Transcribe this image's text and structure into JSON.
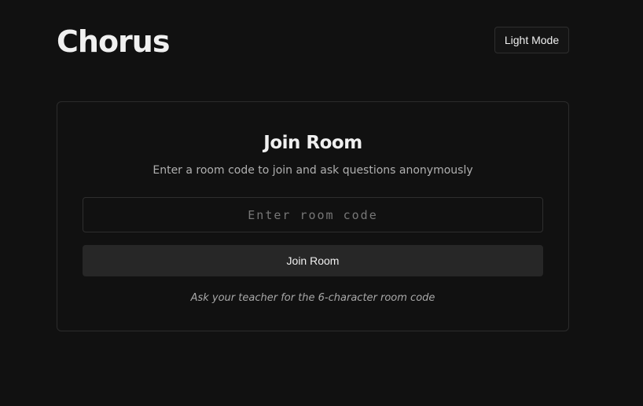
{
  "header": {
    "app_title": "Chorus",
    "theme_toggle_label": "Light Mode"
  },
  "join_card": {
    "title": "Join Room",
    "subtitle": "Enter a room code to join and ask questions anonymously",
    "room_code_input": {
      "value": "",
      "placeholder": "Enter room code"
    },
    "join_button_label": "Join Room",
    "hint": "Ask your teacher for the 6-character room code"
  },
  "colors": {
    "background": "#111111",
    "card_border": "#2c2c2c",
    "button_background": "#272727",
    "text_primary": "#f0f0f0",
    "text_secondary": "#b0b0b0"
  }
}
